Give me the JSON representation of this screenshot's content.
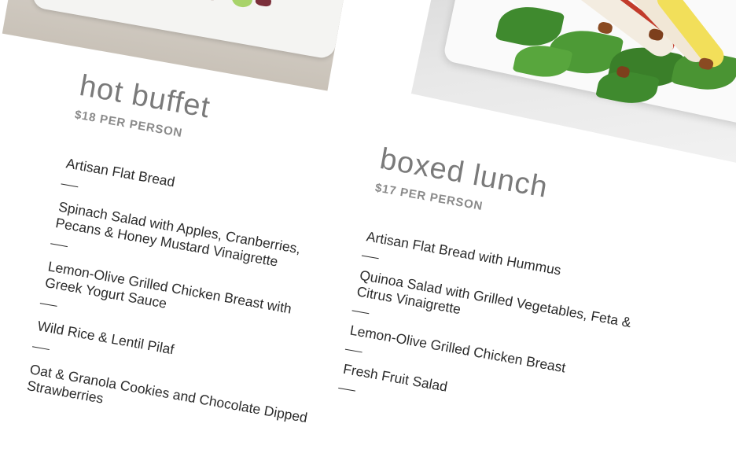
{
  "hot_buffet": {
    "title": "hot buffet",
    "price": "$18 PER PERSON",
    "items": [
      "Artisan Flat Bread",
      "Spinach Salad with Apples, Cranberries, Pecans & Honey Mustard Vinaigrette",
      "Lemon-Olive Grilled Chicken Breast with Greek Yogurt Sauce",
      "Wild Rice & Lentil Pilaf",
      "Oat & Granola Cookies and Chocolate Dipped Strawberries"
    ]
  },
  "boxed_lunch": {
    "title": "boxed lunch",
    "price": "$17 PER PERSON",
    "items": [
      "Artisan Flat Bread with Hummus",
      "Quinoa Salad with Grilled Vegetables, Feta & Citrus Vinaigrette",
      "Lemon-Olive Grilled Chicken Breast",
      "Fresh Fruit Salad"
    ]
  },
  "colors": {
    "title": "#7a7a7a",
    "price": "#8a8a8a",
    "body_text": "#2b2b2b",
    "spinach": "#3f8a2e",
    "apple_red": "#c23b2b",
    "pecan": "#8a4a22"
  }
}
